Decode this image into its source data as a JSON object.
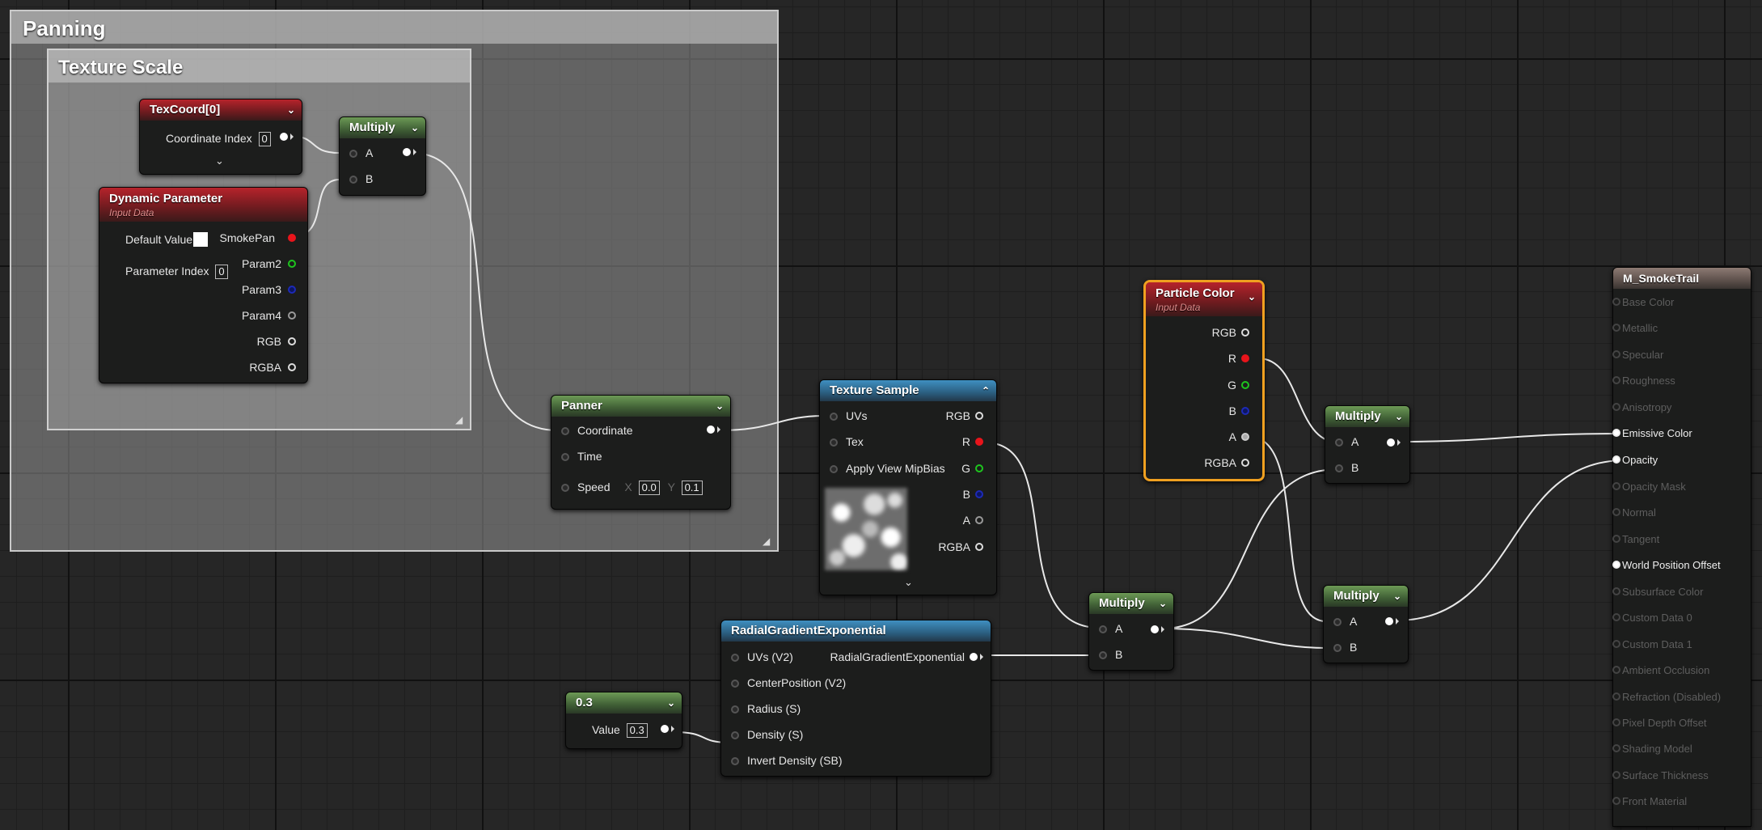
{
  "comments": {
    "panning": "Panning",
    "texture_scale": "Texture Scale"
  },
  "texcoord": {
    "title": "TexCoord[0]",
    "coordinate_index_label": "Coordinate Index",
    "coordinate_index": "0"
  },
  "multiply_top": {
    "title": "Multiply",
    "a": "A",
    "b": "B"
  },
  "dynamic_param": {
    "title": "Dynamic Parameter",
    "subtitle": "Input Data",
    "default_value_label": "Default Value",
    "parameter_index_label": "Parameter Index",
    "parameter_index": "0",
    "outputs": [
      "SmokePan",
      "Param2",
      "Param3",
      "Param4",
      "RGB",
      "RGBA"
    ]
  },
  "panner": {
    "title": "Panner",
    "coordinate": "Coordinate",
    "time": "Time",
    "speed": "Speed",
    "x_label": "X",
    "x_value": "0.0",
    "y_label": "Y",
    "y_value": "0.1"
  },
  "texture_sample": {
    "title": "Texture Sample",
    "inputs": [
      "UVs",
      "Tex",
      "Apply View MipBias"
    ],
    "outputs": [
      "RGB",
      "R",
      "G",
      "B",
      "A",
      "RGBA"
    ]
  },
  "particle_color": {
    "title": "Particle Color",
    "subtitle": "Input Data",
    "outputs": [
      "RGB",
      "R",
      "G",
      "B",
      "A",
      "RGBA"
    ]
  },
  "multiply_mid": {
    "title": "Multiply",
    "a": "A",
    "b": "B"
  },
  "multiply_right_top": {
    "title": "Multiply",
    "a": "A",
    "b": "B"
  },
  "multiply_right_bottom": {
    "title": "Multiply",
    "a": "A",
    "b": "B"
  },
  "radial": {
    "title": "RadialGradientExponential",
    "inputs": [
      "UVs (V2)",
      "CenterPosition (V2)",
      "Radius (S)",
      "Density (S)",
      "Invert Density (SB)"
    ],
    "output": "RadialGradientExponential"
  },
  "constant": {
    "title": "0.3",
    "value_label": "Value",
    "value": "0.3"
  },
  "material": {
    "title": "M_SmokeTrail",
    "inputs": [
      "Base Color",
      "Metallic",
      "Specular",
      "Roughness",
      "Anisotropy",
      "Emissive Color",
      "Opacity",
      "Opacity Mask",
      "Normal",
      "Tangent",
      "World Position Offset",
      "Subsurface Color",
      "Custom Data 0",
      "Custom Data 1",
      "Ambient Occlusion",
      "Refraction (Disabled)",
      "Pixel Depth Offset",
      "Shading Model",
      "Surface Thickness",
      "Front Material"
    ],
    "active_inputs": [
      "Emissive Color",
      "Opacity",
      "World Position Offset"
    ]
  },
  "icons": {
    "chevron": "chevron-down-icon",
    "chevron_up": "chevron-up-icon",
    "resize": "resize-grip-icon"
  },
  "colors": {
    "red_pin": "#e8141b",
    "green_pin": "#1ec51e",
    "blue_pin": "#1d2ab8",
    "selection": "#f0a020"
  }
}
